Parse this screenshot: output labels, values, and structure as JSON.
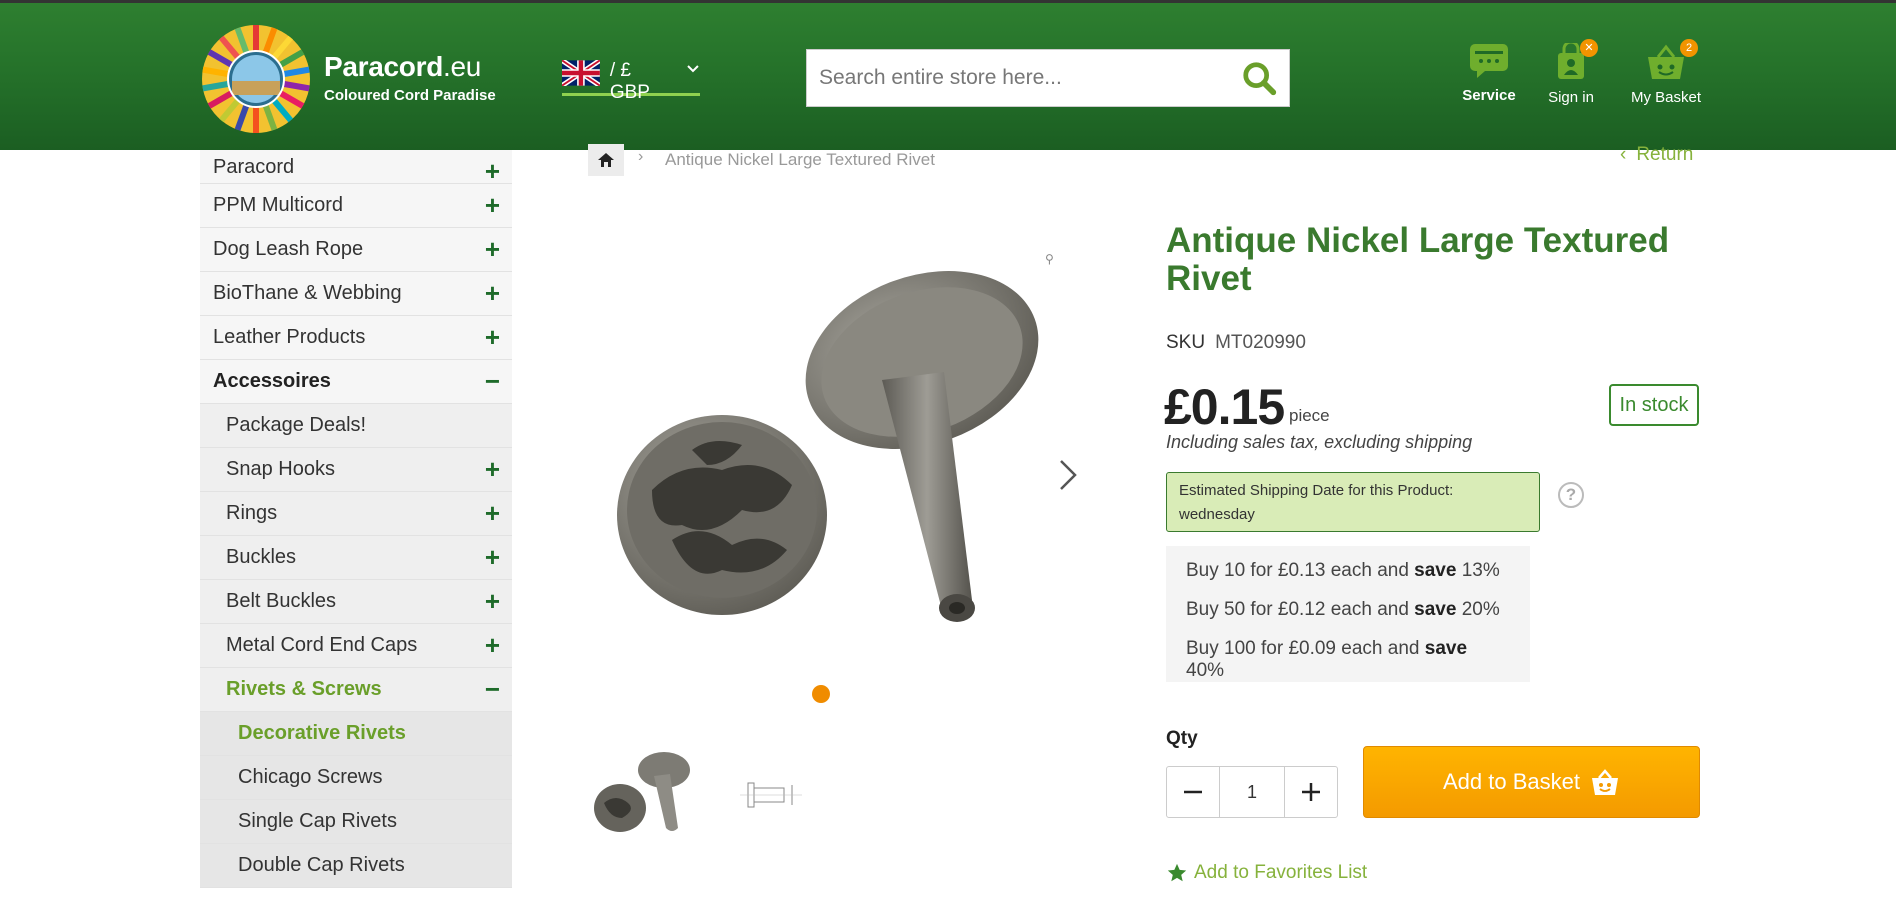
{
  "header": {
    "logo_title_main": "Paracord",
    "logo_title_suffix": ".eu",
    "logo_subtitle": "Coloured Cord Paradise",
    "currency": "/ £ GBP",
    "search_placeholder": "Search entire store here...",
    "service_label": "Service",
    "signin_label": "Sign in",
    "basket_label": "My Basket",
    "basket_count": "2",
    "accent_color": "#8fd14f"
  },
  "sidebar": {
    "items": [
      {
        "label": "Paracord",
        "toggle": "+"
      },
      {
        "label": "PPM Multicord",
        "toggle": "+"
      },
      {
        "label": "Dog Leash Rope",
        "toggle": "+"
      },
      {
        "label": "BioThane & Webbing",
        "toggle": "+"
      },
      {
        "label": "Leather Products",
        "toggle": "+"
      },
      {
        "label": "Accessoires",
        "toggle": "−"
      },
      {
        "label": "Package Deals!",
        "toggle": ""
      },
      {
        "label": "Snap Hooks",
        "toggle": "+"
      },
      {
        "label": "Rings",
        "toggle": "+"
      },
      {
        "label": "Buckles",
        "toggle": "+"
      },
      {
        "label": "Belt Buckles",
        "toggle": "+"
      },
      {
        "label": "Metal Cord End Caps",
        "toggle": "+"
      },
      {
        "label": "Rivets & Screws",
        "toggle": "−"
      },
      {
        "label": "Decorative Rivets",
        "toggle": ""
      },
      {
        "label": "Chicago Screws",
        "toggle": ""
      },
      {
        "label": "Single Cap Rivets",
        "toggle": ""
      },
      {
        "label": "Double Cap Rivets",
        "toggle": ""
      }
    ]
  },
  "breadcrumb": {
    "current": "Antique Nickel Large Textured Rivet",
    "return_label": "Return"
  },
  "product": {
    "title": "Antique Nickel Large Textured Rivet",
    "sku_label": "SKU",
    "sku_value": "MT020990",
    "price": "£0.15",
    "unit": "piece",
    "tax_note": "Including sales tax, excluding shipping",
    "stock": "In stock",
    "shipping_note": "Estimated Shipping Date for this Product: wednesday",
    "tiers": [
      {
        "prefix": "Buy 10 for £0.13 each and",
        "save": "save",
        "pct": "13%"
      },
      {
        "prefix": "Buy 50 for £0.12 each and",
        "save": "save",
        "pct": "20%"
      },
      {
        "prefix": "Buy 100 for £0.09 each and",
        "save": "save",
        "pct": "40%"
      }
    ],
    "qty_label": "Qty",
    "qty_value": "1",
    "add_to_basket": "Add to Basket",
    "favorites": "Add to Favorites List"
  }
}
